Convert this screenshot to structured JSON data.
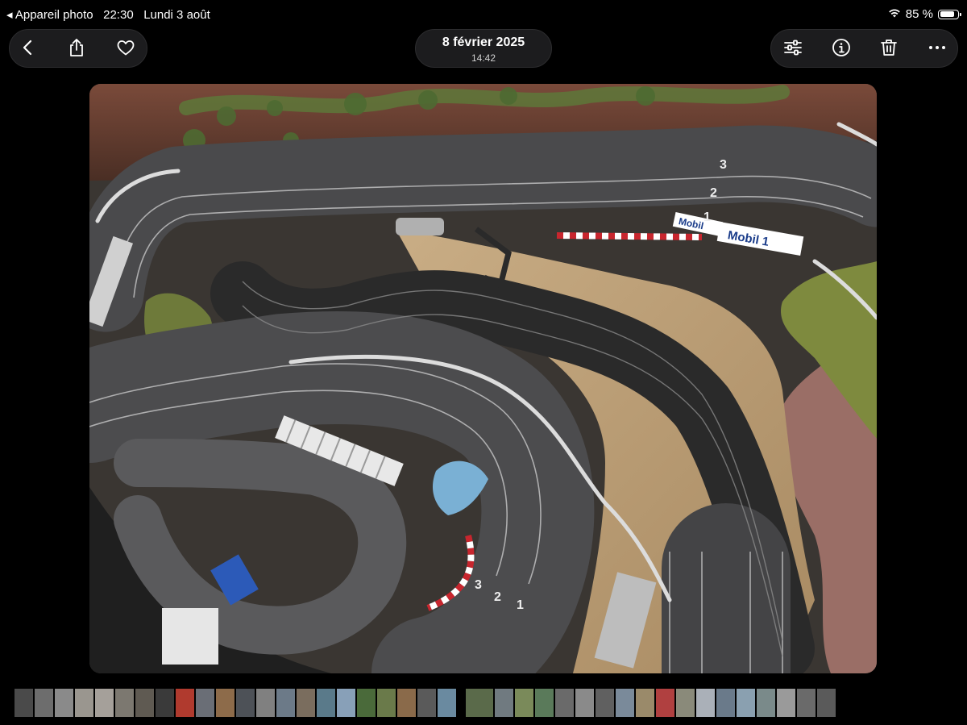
{
  "status_bar": {
    "back_app": "◂ Appareil photo",
    "time": "22:30",
    "date": "Lundi 3 août",
    "battery": "85 %",
    "battery_level": 0.85
  },
  "header": {
    "date": "8 février 2025",
    "time": "14:42"
  },
  "toolbar": {
    "back_icon": "chevron-left-icon",
    "share_icon": "share-icon",
    "favorite_icon": "heart-icon",
    "adjust_icon": "sliders-icon",
    "info_icon": "info-icon",
    "delete_icon": "trash-icon",
    "more_icon": "ellipsis-icon"
  },
  "photo": {
    "signs": [
      "Mobil",
      "1",
      "Mobil 1"
    ],
    "track_numbers": [
      "3",
      "2",
      "1"
    ]
  },
  "thumbnails": {
    "colors": [
      "#4a4a4a",
      "#6d6d6d",
      "#8a8a8a",
      "#9a968f",
      "#a5a09a",
      "#7c7870",
      "#5f5a52",
      "#3a3a3a",
      "#b03a2e",
      "#6a6e76",
      "#8d6b4a",
      "#4d5157",
      "#808080",
      "#6c7a88",
      "#7a6d5e",
      "#5a7a8a",
      "#88a0b8",
      "#4a6a3a",
      "#6a7a4a",
      "#8a6a4a",
      "#5a5a5a",
      "#6a8aa0",
      "#5a6a4a",
      "#707a80",
      "#7a8a5a",
      "#5a7a5a",
      "#6a6a6a",
      "#8a8a8a",
      "#606060",
      "#7a8a9a",
      "#9a8a6a",
      "#b04040",
      "#8a8a7a",
      "#aab0b8",
      "#6a7a8a",
      "#8aa0b0",
      "#7a8a8a",
      "#9a9a9a",
      "#6a6a6a",
      "#5a5a5a"
    ],
    "selected_index": 22
  },
  "colors": {
    "toolbar_bg": "#1c1c1e",
    "background": "#000000"
  }
}
